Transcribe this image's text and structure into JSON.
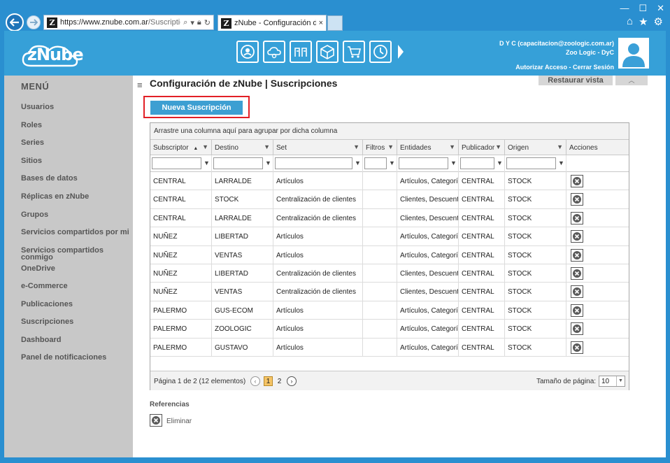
{
  "browser": {
    "url_main": "https://www.znube.com.ar",
    "url_path": "/Suscriptio",
    "tab_title": "zNube - Configuración de z...",
    "tab_close": "×"
  },
  "header": {
    "brand": "zNube",
    "user_line1": "D Y C (capacitacion@zoologic.com.ar)",
    "user_line2": "Zoo Logic - DyC",
    "links": "Autorizar Acceso - Cerrar Sesión"
  },
  "sidebar": {
    "title": "MENÚ",
    "items": [
      {
        "label": "Usuarios"
      },
      {
        "label": "Roles"
      },
      {
        "label": "Series"
      },
      {
        "label": "Sitios"
      },
      {
        "label": "Bases de datos"
      },
      {
        "label": "Réplicas en zNube"
      },
      {
        "label": "Grupos"
      },
      {
        "label": "Servicios compartidos por mi"
      },
      {
        "label": "Servicios compartidos"
      },
      {
        "label": "conmigo"
      },
      {
        "label": "OneDrive"
      },
      {
        "label": "e-Commerce"
      },
      {
        "label": "Publicaciones"
      },
      {
        "label": "Suscripciones"
      },
      {
        "label": "Dashboard"
      },
      {
        "label": "Panel de notificaciones"
      }
    ]
  },
  "main": {
    "title": "Configuración de zNube | Suscripciones",
    "restore_label": "Restaurar vista",
    "collapse_symbol": "︿",
    "new_button": "Nueva Suscripción",
    "group_hint": "Arrastre una columna aquí para agrupar por dicha columna"
  },
  "grid": {
    "columns": [
      "Subscriptor",
      "Destino",
      "Set",
      "Filtros",
      "Entidades",
      "Publicador",
      "Origen",
      "Acciones"
    ],
    "sort_indicator": "▲",
    "rows": [
      [
        "CENTRAL",
        "LARRALDE",
        "Artículos",
        "",
        "Artículos, Categorí",
        "CENTRAL",
        "STOCK"
      ],
      [
        "CENTRAL",
        "STOCK",
        "Centralización de clientes",
        "",
        "Clientes, Descuent",
        "CENTRAL",
        "STOCK"
      ],
      [
        "CENTRAL",
        "LARRALDE",
        "Centralización de clientes",
        "",
        "Clientes, Descuent",
        "CENTRAL",
        "STOCK"
      ],
      [
        "NUÑEZ",
        "LIBERTAD",
        "Artículos",
        "",
        "Artículos, Categorí",
        "CENTRAL",
        "STOCK"
      ],
      [
        "NUÑEZ",
        "VENTAS",
        "Artículos",
        "",
        "Artículos, Categorí",
        "CENTRAL",
        "STOCK"
      ],
      [
        "NUÑEZ",
        "LIBERTAD",
        "Centralización de clientes",
        "",
        "Clientes, Descuent",
        "CENTRAL",
        "STOCK"
      ],
      [
        "NUÑEZ",
        "VENTAS",
        "Centralización de clientes",
        "",
        "Clientes, Descuent",
        "CENTRAL",
        "STOCK"
      ],
      [
        "PALERMO",
        "GUS-ECOM",
        "Artículos",
        "",
        "Artículos, Categorí",
        "CENTRAL",
        "STOCK"
      ],
      [
        "PALERMO",
        "ZOOLOGIC",
        "Artículos",
        "",
        "Artículos, Categorí",
        "CENTRAL",
        "STOCK"
      ],
      [
        "PALERMO",
        "GUSTAVO",
        "Artículos",
        "",
        "Artículos, Categorí",
        "CENTRAL",
        "STOCK"
      ]
    ],
    "pager_info": "Página 1 de 2 (12 elementos)",
    "pages": [
      "1",
      "2"
    ],
    "page_size_label": "Tamaño de página:",
    "page_size": "10"
  },
  "references": {
    "title": "Referencias",
    "delete_label": "Eliminar"
  },
  "colors": {
    "accent": "#36a0d8",
    "frame": "#2a8fd0",
    "highlight": "#e21f26"
  }
}
